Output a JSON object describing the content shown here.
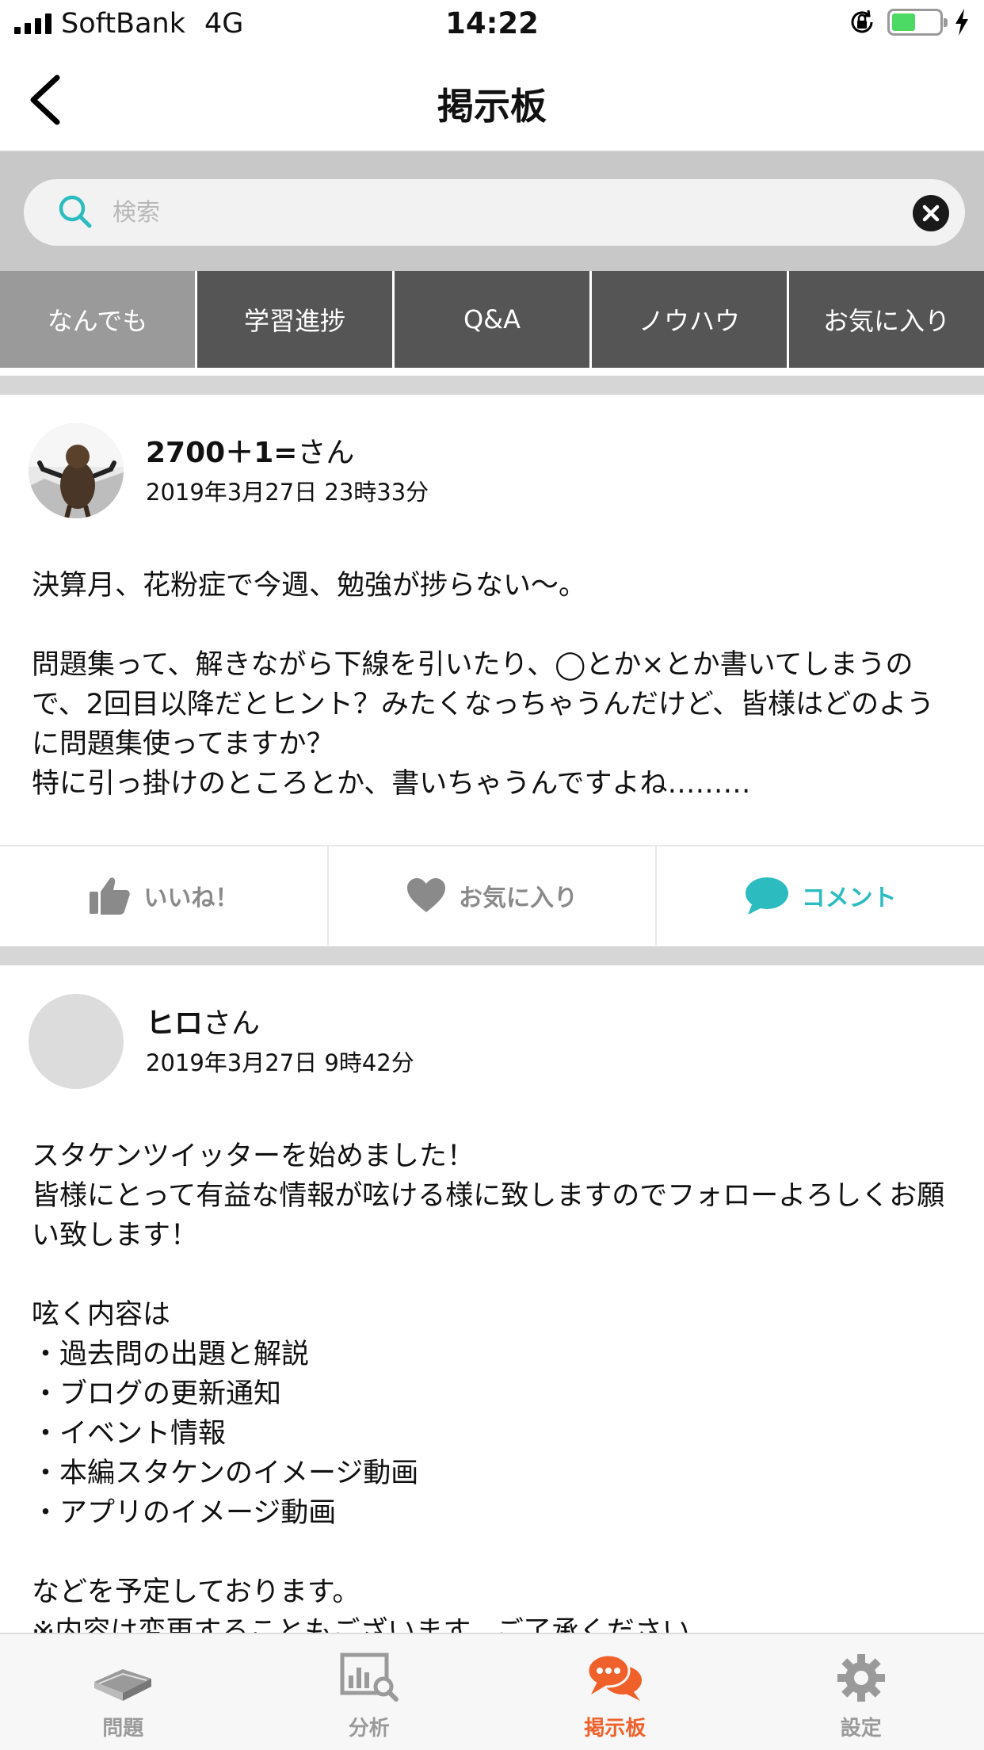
{
  "status_bar": {
    "carrier": "SoftBank",
    "network": "4G",
    "time": "14:22"
  },
  "nav": {
    "title": "掲示板"
  },
  "search": {
    "placeholder": "検索"
  },
  "tabs": [
    {
      "label": "なんでも",
      "active": true
    },
    {
      "label": "学習進捗",
      "active": false
    },
    {
      "label": "Q&A",
      "active": false
    },
    {
      "label": "ノウハウ",
      "active": false
    },
    {
      "label": "お気に入り",
      "active": false
    }
  ],
  "posts": [
    {
      "user_name": "2700＋1=",
      "user_suffix": "さん",
      "date": "2019年3月27日 23時33分",
      "body": "決算月、花粉症で今週、勉強が捗らない〜。\n\n問題集って、解きながら下線を引いたり、◯とか×とか書いてしまうので、2回目以降だとヒント？みたくなっちゃうんだけど、皆様はどのように問題集使ってますか？\n特に引っ掛けのところとか、書いちゃうんですよね………",
      "actions": {
        "like": "いいね！",
        "favorite": "お気に入り",
        "comment": "コメント"
      }
    },
    {
      "user_name": "ヒロ",
      "user_suffix": "さん",
      "date": "2019年3月27日 9時42分",
      "body": "スタケンツイッターを始めました！\n皆様にとって有益な情報が呟ける様に致しますのでフォローよろしくお願い致します！\n\n呟く内容は\n・過去問の出題と解説\n・ブログの更新通知\n・イベント情報\n・本編スタケンのイメージ動画\n・アプリのイメージ動画\n\nなどを予定しております。\n※内容は変更することもございます。ご了承ください。"
    }
  ],
  "tab_bar": [
    {
      "label": "問題",
      "icon": "book-icon",
      "active": false
    },
    {
      "label": "分析",
      "icon": "analytics-icon",
      "active": false
    },
    {
      "label": "掲示板",
      "icon": "chat-bubbles-icon",
      "active": true
    },
    {
      "label": "設定",
      "icon": "gear-icon",
      "active": false
    }
  ],
  "colors": {
    "accent_teal": "#2cbcc0",
    "active_orange": "#f0602a",
    "tab_dark": "#555555",
    "tab_active": "#9a9a9a",
    "battery_green": "#4cd964"
  }
}
